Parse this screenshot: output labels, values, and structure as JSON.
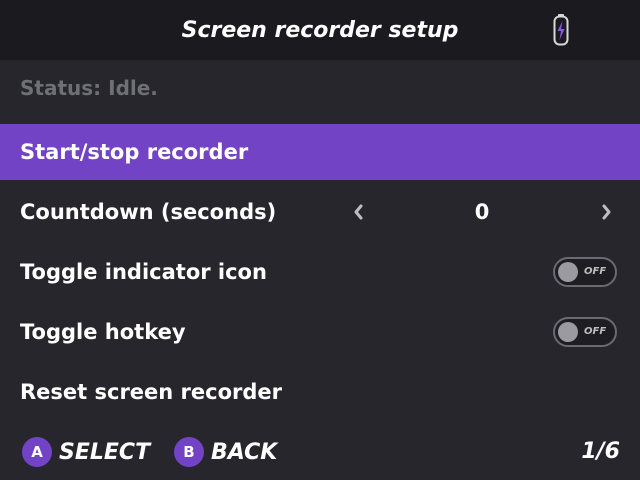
{
  "header": {
    "title": "Screen recorder setup",
    "battery_icon": "charging-battery-icon"
  },
  "status": "Status: Idle.",
  "menu": {
    "items": [
      {
        "label": "Start/stop recorder",
        "selected": true
      },
      {
        "label": "Countdown (seconds)",
        "type": "selector",
        "value": "0"
      },
      {
        "label": "Toggle indicator icon",
        "type": "toggle",
        "state": "OFF"
      },
      {
        "label": "Toggle hotkey",
        "type": "toggle",
        "state": "OFF"
      },
      {
        "label": "Reset screen recorder"
      }
    ]
  },
  "footer": {
    "a_button": "A",
    "a_label": "SELECT",
    "b_button": "B",
    "b_label": "BACK",
    "page": "1/6"
  },
  "colors": {
    "accent": "#7243c4",
    "background": "#26262c",
    "header_background": "#1b1b1f",
    "status_text": "#6f6f76"
  }
}
